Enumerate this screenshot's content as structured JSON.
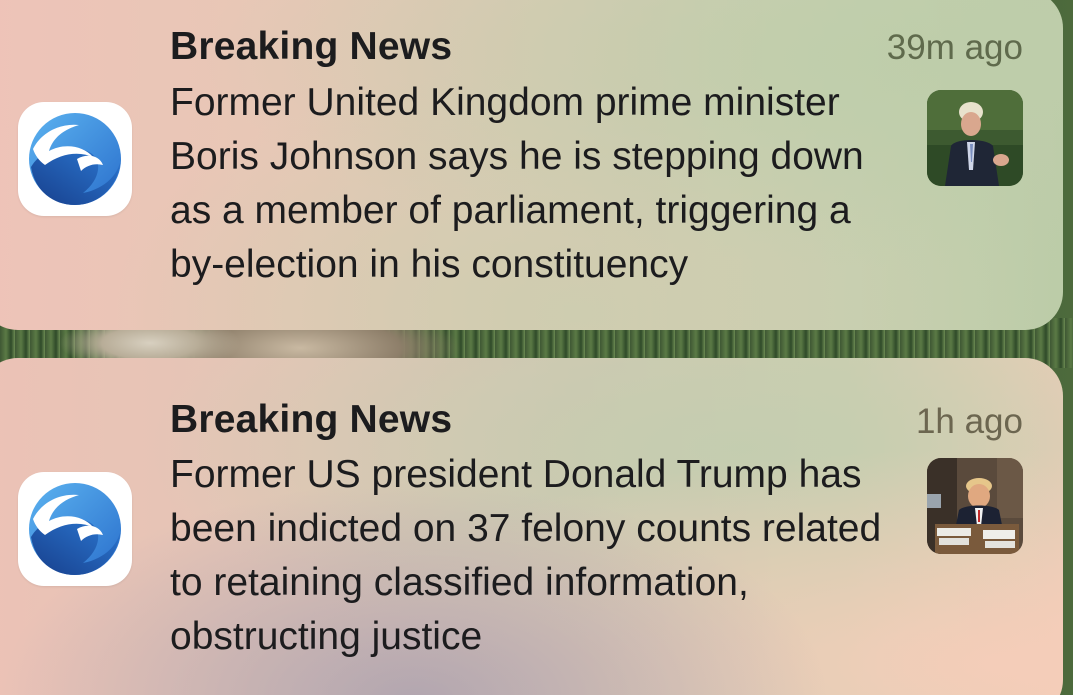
{
  "notifications": [
    {
      "title": "Breaking News",
      "time": "39m ago",
      "body": "Former United Kingdom prime minister Boris Johnson says he is stepping down as a member of parliament, triggering a by-election in his constituency",
      "app_icon": "news-app-icon",
      "thumbnail": "boris-johnson-photo"
    },
    {
      "title": "Breaking News",
      "time": "1h ago",
      "body": "Former US president Donald Trump has been indicted on 37 felony counts related to retaining classified information, obstructing justice",
      "app_icon": "news-app-icon",
      "thumbnail": "donald-trump-photo"
    }
  ],
  "colors": {
    "icon_blue": "#2f7fd6",
    "icon_dark_blue": "#1b4f9c",
    "title_text": "#1c1c1e"
  }
}
